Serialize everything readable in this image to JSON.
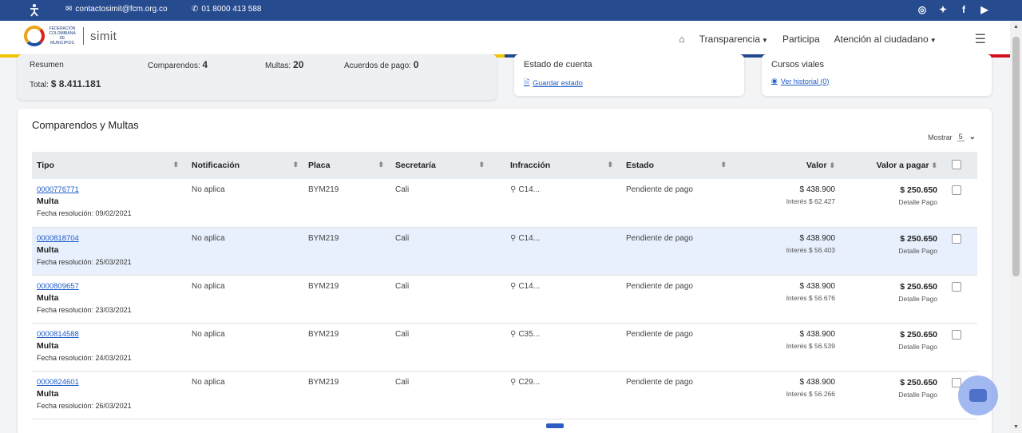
{
  "topbar": {
    "email": "contactosimit@fcm.org.co",
    "phone": "01 8000 413 588",
    "social": [
      "instagram-icon",
      "twitter-icon",
      "facebook-icon",
      "youtube-icon"
    ]
  },
  "header": {
    "logo_text": "FEDERACIÓN COLOMBIANA DE MUNICIPIOS",
    "brand": "simit",
    "nav": [
      "Transparencia",
      "Participa",
      "Atención al ciudadano"
    ]
  },
  "summary": {
    "resumen": "Resumen",
    "comparendos_label": "Comparendos:",
    "comparendos_value": "4",
    "multas_label": "Multas:",
    "multas_value": "20",
    "acuerdos_label": "Acuerdos de pago:",
    "acuerdos_value": "0",
    "total_label": "Total:",
    "total_value": "$ 8.411.181"
  },
  "estado": {
    "title": "Estado de cuenta",
    "link": "Guardar estado"
  },
  "cursos": {
    "title": "Cursos viales",
    "link": "Ver historial (0)"
  },
  "main": {
    "title": "Comparendos y Multas",
    "mostrar_label": "Mostrar",
    "mostrar_value": "5",
    "headers": [
      "Tipo",
      "Notificación",
      "Placa",
      "Secretaría",
      "Infracción",
      "Estado",
      "Valor",
      "Valor a pagar"
    ],
    "rows": [
      {
        "num": "0000776771",
        "tipo": "Multa",
        "fecha": "Fecha resolución: 09/02/2021",
        "notif": "No aplica",
        "placa": "BYM219",
        "sec": "Cali",
        "infr": "C14...",
        "estado": "Pendiente de pago",
        "valor": "$ 438.900",
        "interes": "Interés $ 62.427",
        "vpagar": "$ 250.650",
        "detalle": "Detalle Pago"
      },
      {
        "num": "0000818704",
        "tipo": "Multa",
        "fecha": "Fecha resolución: 25/03/2021",
        "notif": "No aplica",
        "placa": "BYM219",
        "sec": "Cali",
        "infr": "C14...",
        "estado": "Pendiente de pago",
        "valor": "$ 438.900",
        "interes": "Interés $ 56.403",
        "vpagar": "$ 250.650",
        "detalle": "Detalle Pago"
      },
      {
        "num": "0000809657",
        "tipo": "Multa",
        "fecha": "Fecha resolución: 23/03/2021",
        "notif": "No aplica",
        "placa": "BYM219",
        "sec": "Cali",
        "infr": "C14...",
        "estado": "Pendiente de pago",
        "valor": "$ 438.900",
        "interes": "Interés $ 56.676",
        "vpagar": "$ 250.650",
        "detalle": "Detalle Pago"
      },
      {
        "num": "0000814588",
        "tipo": "Multa",
        "fecha": "Fecha resolución: 24/03/2021",
        "notif": "No aplica",
        "placa": "BYM219",
        "sec": "Cali",
        "infr": "C35...",
        "estado": "Pendiente de pago",
        "valor": "$ 438.900",
        "interes": "Interés $ 56.539",
        "vpagar": "$ 250.650",
        "detalle": "Detalle Pago"
      },
      {
        "num": "0000824601",
        "tipo": "Multa",
        "fecha": "Fecha resolución: 26/03/2021",
        "notif": "No aplica",
        "placa": "BYM219",
        "sec": "Cali",
        "infr": "C29...",
        "estado": "Pendiente de pago",
        "valor": "$ 438.900",
        "interes": "Interés $ 56.266",
        "vpagar": "$ 250.650",
        "detalle": "Detalle Pago"
      }
    ]
  }
}
